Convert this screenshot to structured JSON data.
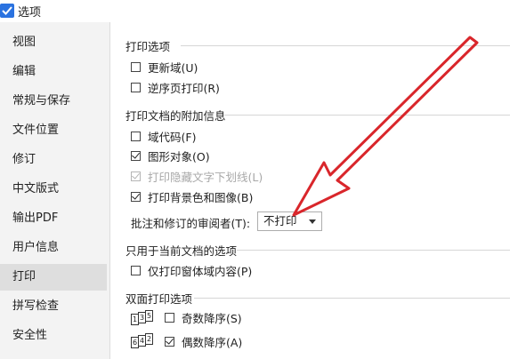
{
  "window": {
    "title": "选项"
  },
  "sidebar": {
    "items": [
      {
        "label": "视图"
      },
      {
        "label": "编辑"
      },
      {
        "label": "常规与保存"
      },
      {
        "label": "文件位置"
      },
      {
        "label": "修订"
      },
      {
        "label": "中文版式"
      },
      {
        "label": "输出PDF"
      },
      {
        "label": "用户信息"
      },
      {
        "label": "打印",
        "active": true
      },
      {
        "label": "拼写检查"
      },
      {
        "label": "安全性"
      }
    ]
  },
  "print_options": {
    "title": "打印选项",
    "update_fields": {
      "label": "更新域(U)",
      "checked": false
    },
    "reverse_order": {
      "label": "逆序页打印(R)",
      "checked": false
    }
  },
  "extra_info": {
    "title": "打印文档的附加信息",
    "field_codes": {
      "label": "域代码(F)",
      "checked": false
    },
    "drawing_objects": {
      "label": "图形对象(O)",
      "checked": true
    },
    "hidden_text_underline": {
      "label": "打印隐藏文字下划线(L)",
      "checked": true,
      "disabled": true
    },
    "background": {
      "label": "打印背景色和图像(B)",
      "checked": true
    },
    "reviewer_label": "批注和修订的审阅者(T):",
    "reviewer_value": "不打印"
  },
  "current_doc": {
    "title": "只用于当前文档的选项",
    "form_data_only": {
      "label": "仅打印窗体域内容(P)",
      "checked": false
    }
  },
  "duplex": {
    "title": "双面打印选项",
    "odd_reverse": {
      "label": "奇数降序(S)",
      "checked": false,
      "pages": [
        "1",
        "3",
        "5"
      ]
    },
    "even_reverse": {
      "label": "偶数降序(A)",
      "checked": true,
      "pages": [
        "6",
        "4",
        "2"
      ]
    }
  },
  "colors": {
    "annotation_arrow": "#d9262b",
    "selected_nav": "#dedede"
  }
}
